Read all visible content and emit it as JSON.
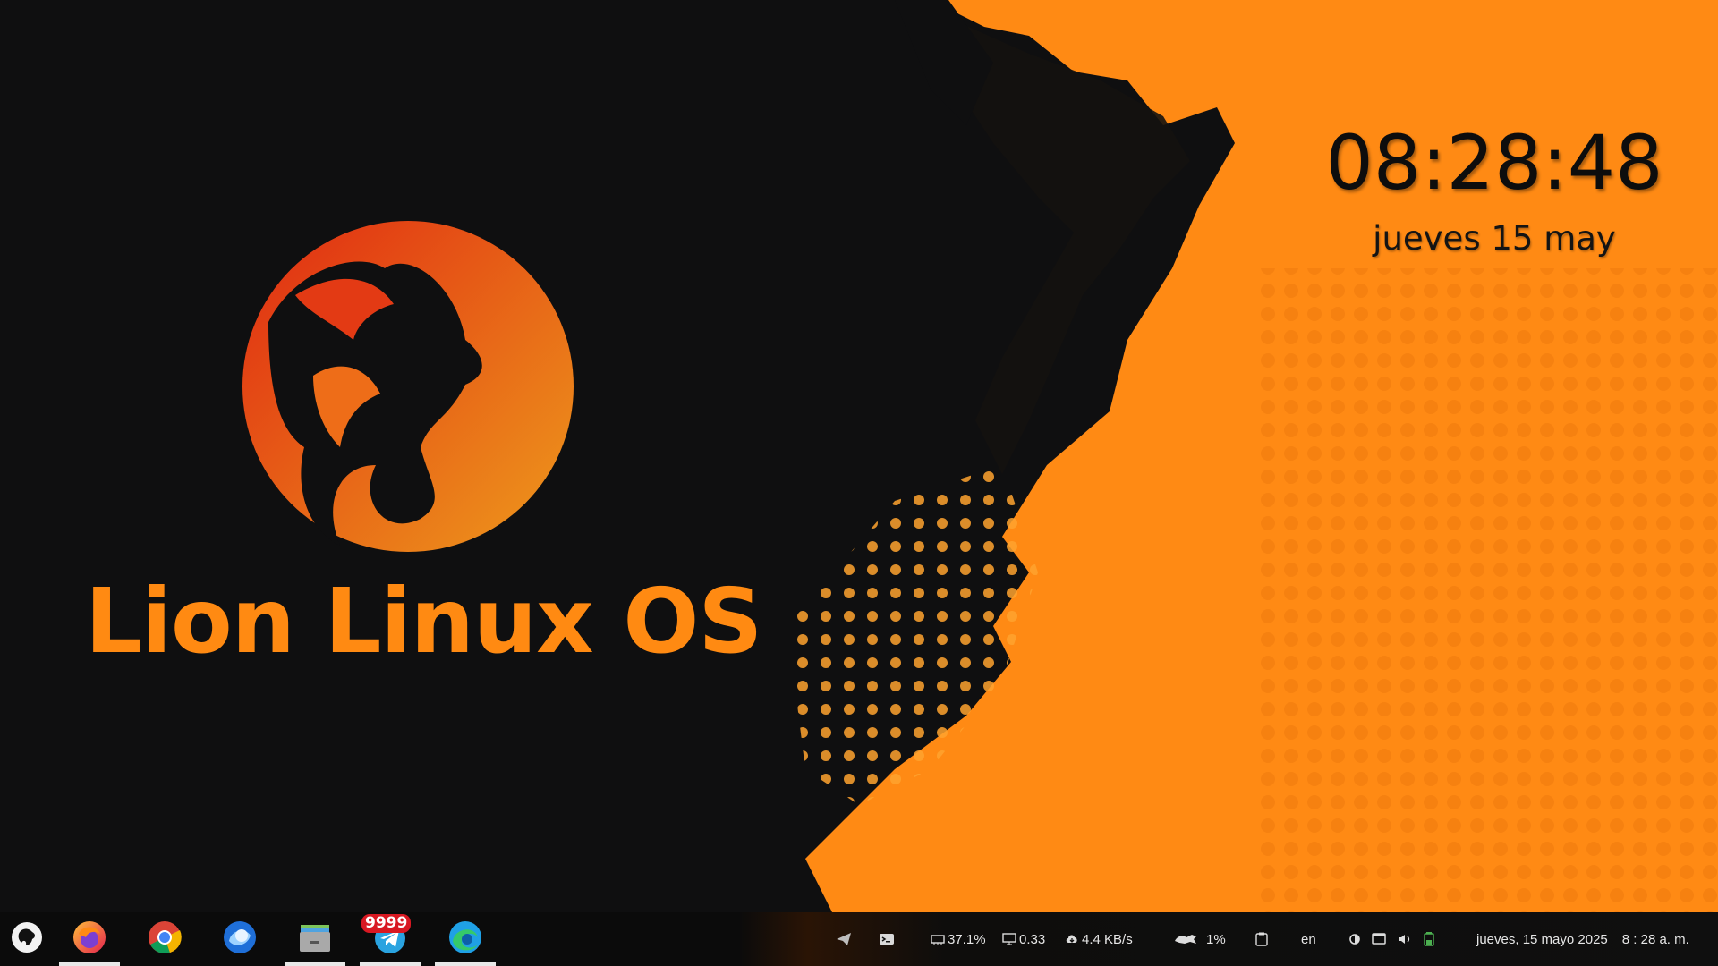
{
  "desktop": {
    "logo_text": "Lion Linux OS",
    "clock_time": "08:28:48",
    "clock_date": "jueves 15 may",
    "colors": {
      "accent_orange": "#ff8a12",
      "background_dark": "#0f0f10",
      "logo_red": "#e02a12"
    }
  },
  "taskbar": {
    "apps": [
      {
        "name": "lion-menu",
        "icon": "lion-icon",
        "running": false
      },
      {
        "name": "firefox",
        "icon": "firefox-icon",
        "running": true
      },
      {
        "name": "chrome",
        "icon": "chrome-icon",
        "running": false
      },
      {
        "name": "thunderbird",
        "icon": "thunderbird-icon",
        "running": false
      },
      {
        "name": "files",
        "icon": "file-manager-icon",
        "running": true
      },
      {
        "name": "telegram",
        "icon": "telegram-icon",
        "running": true,
        "badge": "9999"
      },
      {
        "name": "edge",
        "icon": "edge-icon",
        "running": true
      }
    ],
    "tray": {
      "memory": "37.1%",
      "load": "0.33",
      "network": "4.4 KB/s",
      "cpu": "1%",
      "keyboard_layout": "en",
      "date": "jueves, 15  mayo 2025",
      "time": "8 : 28 a. m."
    }
  }
}
